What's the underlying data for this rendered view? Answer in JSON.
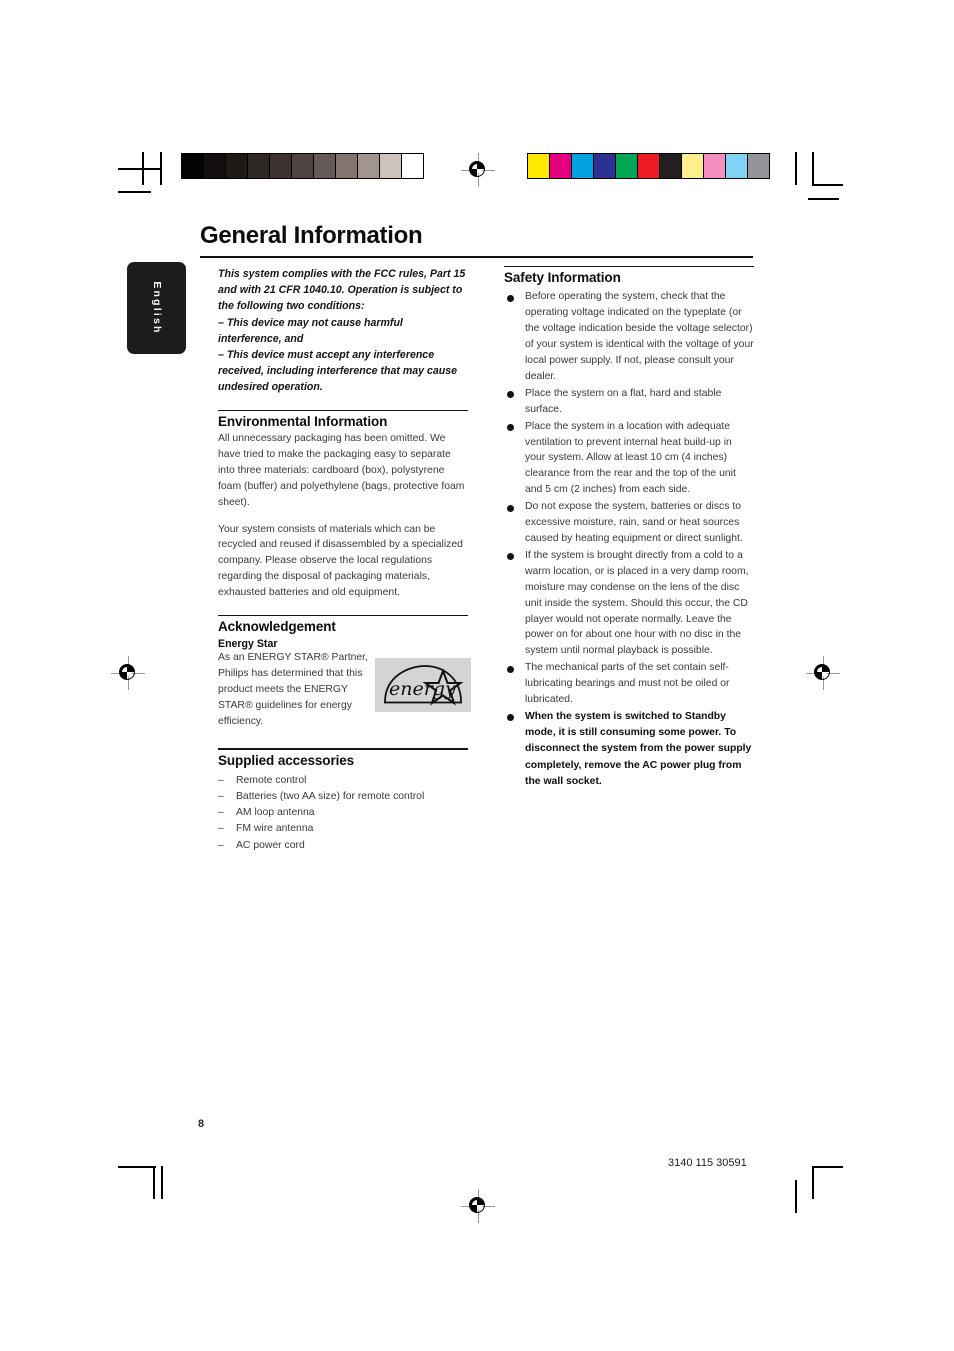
{
  "document": {
    "language_tab": "English",
    "title": "General Information",
    "page_number": "8",
    "doc_code": "3140 115 30591"
  },
  "left_column": {
    "fcc_notice": {
      "intro": "This system complies with the FCC rules, Part 15 and with 21 CFR 1040.10. Operation is subject to the following two conditions:",
      "condition_1": "–  This device may not cause harmful interference, and",
      "condition_2": "–  This device must accept any interference received, including interference that may cause undesired operation."
    },
    "environmental": {
      "heading": "Environmental Information",
      "paragraph_1": "All unnecessary packaging has been omitted. We have tried to make the packaging easy to separate into three materials: cardboard (box), polystyrene foam (buffer) and polyethylene (bags, protective foam sheet).",
      "paragraph_2": "Your system consists of materials which can be recycled and reused if disassembled by a specialized company. Please observe the local regulations regarding the disposal of packaging materials, exhausted batteries and old equipment."
    },
    "acknowledgement": {
      "heading": "Acknowledgement",
      "sub_heading": "Energy Star",
      "body": "As an ENERGY STAR® Partner, Philips has determined that this product meets the ENERGY STAR® guidelines for energy efficiency.",
      "logo_text": "energy"
    },
    "supplied_accessories": {
      "heading": "Supplied accessories",
      "items": [
        "Remote control",
        "Batteries (two AA size) for remote control",
        "AM loop antenna",
        "FM wire antenna",
        "AC power cord"
      ]
    }
  },
  "right_column": {
    "safety": {
      "heading": "Safety Information",
      "items": [
        {
          "text": "Before operating the system, check that the operating voltage indicated on the typeplate (or the voltage indication beside the voltage selector) of your system is identical with the voltage of your local power supply. If not, please consult your dealer.",
          "bold": false
        },
        {
          "text": "Place the system on a flat, hard and stable surface.",
          "bold": false
        },
        {
          "text": "Place the system in a location with adequate ventilation to prevent internal heat build-up in your system.  Allow at least 10 cm (4 inches) clearance from the rear and the top of the unit and 5 cm (2 inches) from each side.",
          "bold": false
        },
        {
          "text": "Do not expose the system, batteries or discs to excessive moisture, rain, sand or heat sources caused by heating equipment or direct sunlight.",
          "bold": false
        },
        {
          "text": "If the system is brought directly from a cold to a warm location, or is placed in a very damp room, moisture may condense on the lens of the disc unit inside the system. Should this occur, the CD player would not operate normally. Leave the power on for about one hour with no disc in the system until normal playback is possible.",
          "bold": false
        },
        {
          "text": "The mechanical parts of the set contain self-lubricating bearings and must not be oiled or lubricated.",
          "bold": false
        },
        {
          "text": "When the system is switched to Standby mode, it is still consuming some power. To disconnect the system from the power supply completely, remove the AC power plug from the wall socket.",
          "bold": true
        }
      ]
    }
  },
  "print_marks": {
    "grayscale_bar": [
      "#020202",
      "#120f0e",
      "#1d1917",
      "#2e2724",
      "#3c3330",
      "#4f4441",
      "#665a56",
      "#82756f",
      "#a2948e",
      "#cdc3bd",
      "#ffffff"
    ],
    "color_bar": [
      "#ffe800",
      "#e5007d",
      "#00a3e0",
      "#2e3192",
      "#00a651",
      "#ed1c24",
      "#231f20",
      "#fdf08a",
      "#f58fc2",
      "#7fd4f5",
      "#939598"
    ]
  }
}
